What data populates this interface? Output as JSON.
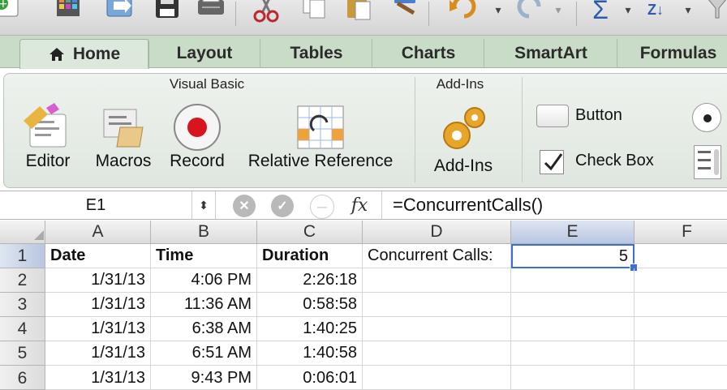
{
  "toolbar": {
    "icons": [
      "new-icon",
      "gallery-icon",
      "open-icon",
      "save-icon",
      "print-icon",
      "cut-icon",
      "copy-icon",
      "paste-icon",
      "format-painter-icon",
      "undo-icon",
      "redo-icon",
      "autosum-icon",
      "sort-icon",
      "filter-icon"
    ]
  },
  "tabs": [
    {
      "label": "Home"
    },
    {
      "label": "Layout"
    },
    {
      "label": "Tables"
    },
    {
      "label": "Charts"
    },
    {
      "label": "SmartArt"
    },
    {
      "label": "Formulas"
    }
  ],
  "ribbon": {
    "visual_basic_title": "Visual Basic",
    "addins_title": "Add-Ins",
    "editor": "Editor",
    "macros": "Macros",
    "record": "Record",
    "relative_reference": "Relative Reference",
    "addins": "Add-Ins",
    "button": "Button",
    "check_box": "Check Box"
  },
  "formula_bar": {
    "name_box": "E1",
    "formula": "=ConcurrentCalls()"
  },
  "grid": {
    "columns": [
      "A",
      "B",
      "C",
      "D",
      "E",
      "F"
    ],
    "rows": [
      {
        "num": "1",
        "a": "Date",
        "b": "Time",
        "c": "Duration",
        "d": "Concurrent Calls:",
        "e": "5"
      },
      {
        "num": "2",
        "a": "1/31/13",
        "b": "4:06 PM",
        "c": "2:26:18",
        "d": "",
        "e": ""
      },
      {
        "num": "3",
        "a": "1/31/13",
        "b": "11:36 AM",
        "c": "0:58:58",
        "d": "",
        "e": ""
      },
      {
        "num": "4",
        "a": "1/31/13",
        "b": "6:38 AM",
        "c": "1:40:25",
        "d": "",
        "e": ""
      },
      {
        "num": "5",
        "a": "1/31/13",
        "b": "6:51 AM",
        "c": "1:40:58",
        "d": "",
        "e": ""
      },
      {
        "num": "6",
        "a": "1/31/13",
        "b": "9:43 PM",
        "c": "0:06:01",
        "d": "",
        "e": ""
      }
    ]
  },
  "colors": {
    "selection": "#3a6fd8",
    "tab_bar": "#c9dcc8",
    "record": "#d8141c"
  }
}
